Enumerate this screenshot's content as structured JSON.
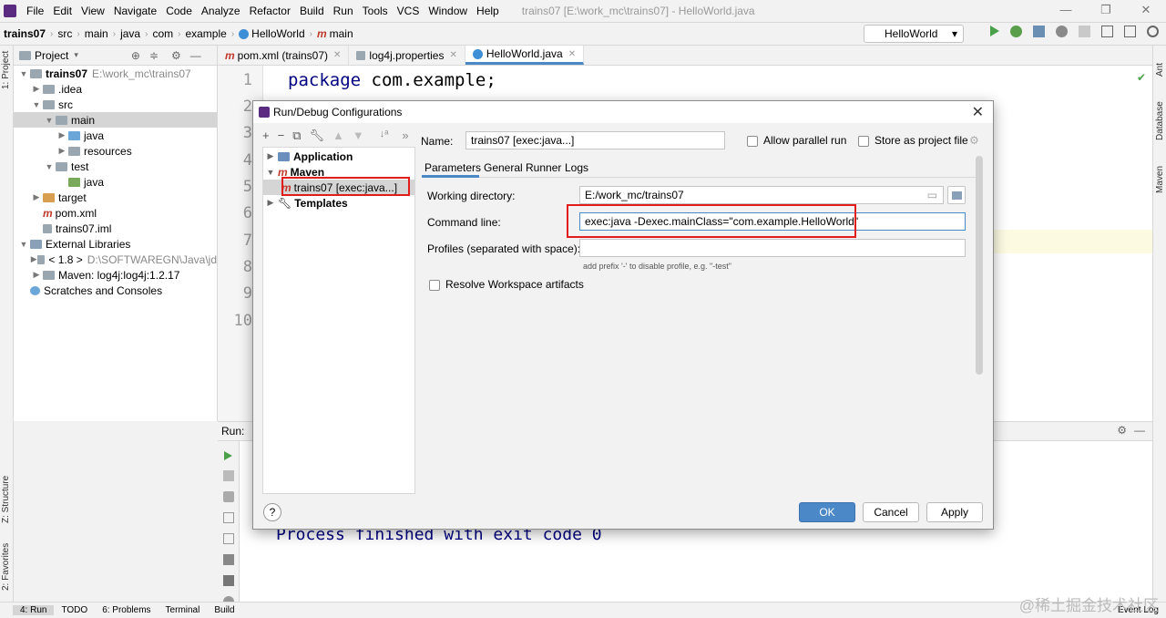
{
  "menubar": {
    "items": [
      "File",
      "Edit",
      "View",
      "Navigate",
      "Code",
      "Analyze",
      "Refactor",
      "Build",
      "Run",
      "Tools",
      "VCS",
      "Window",
      "Help"
    ],
    "title": "trains07 [E:\\work_mc\\trains07] - HelloWorld.java"
  },
  "navbar": {
    "crumbs": [
      "trains07",
      "src",
      "main",
      "java",
      "com",
      "example",
      "HelloWorld",
      "main"
    ]
  },
  "run_config_select": "HelloWorld",
  "left_strip": {
    "project": "1: Project",
    "structure": "Z: Structure",
    "favorites": "2: Favorites"
  },
  "right_strip": {
    "ant": "Ant",
    "database": "Database",
    "maven": "Maven"
  },
  "project_panel": {
    "header": "Project",
    "tree": [
      {
        "label": "trains07",
        "extra": "E:\\work_mc\\trains07"
      },
      {
        "label": ".idea"
      },
      {
        "label": "src"
      },
      {
        "label": "main"
      },
      {
        "label": "java"
      },
      {
        "label": "resources"
      },
      {
        "label": "test"
      },
      {
        "label": "java"
      },
      {
        "label": "target"
      },
      {
        "label": "pom.xml"
      },
      {
        "label": "trains07.iml"
      },
      {
        "label": "External Libraries"
      },
      {
        "label": "< 1.8 >",
        "extra": "D:\\SOFTWAREGN\\Java\\jd"
      },
      {
        "label": "Maven: log4j:log4j:1.2.17"
      },
      {
        "label": "Scratches and Consoles"
      }
    ]
  },
  "editor": {
    "tabs": [
      "pom.xml (trains07)",
      "log4j.properties",
      "HelloWorld.java"
    ],
    "line_numbers": [
      "1",
      "2",
      "3",
      "4",
      "5",
      "6",
      "7",
      "8",
      "9",
      "10"
    ],
    "code_kw": "package",
    "code_rest": " com.example;"
  },
  "run_panel": {
    "label": "Run:",
    "output": "Process finished with exit code 0"
  },
  "statusbar": {
    "items": [
      "4: Run",
      "TODO",
      "6: Problems",
      "Terminal",
      "Build"
    ],
    "event_log": "Event Log"
  },
  "watermark": "@稀土掘金技术社区",
  "dialog": {
    "title": "Run/Debug Configurations",
    "tree": {
      "application": "Application",
      "maven": "Maven",
      "config": "trains07 [exec:java...]",
      "templates": "Templates"
    },
    "name_label": "Name:",
    "name_value": "trains07 [exec:java...]",
    "allow_parallel": "Allow parallel run",
    "store_project": "Store as project file",
    "tabs": [
      "Parameters",
      "General",
      "Runner",
      "Logs"
    ],
    "working_dir_label": "Working directory:",
    "working_dir_value": "E:/work_mc/trains07",
    "command_line_label": "Command line:",
    "command_line_value": "exec:java -Dexec.mainClass=\"com.example.HelloWorld\"",
    "profiles_label": "Profiles (separated with space):",
    "profiles_hint": "add prefix '-' to disable profile, e.g. \"-test\"",
    "resolve_workspace": "Resolve Workspace artifacts",
    "buttons": {
      "ok": "OK",
      "cancel": "Cancel",
      "apply": "Apply",
      "help": "?"
    }
  },
  "colors": {
    "accent": "#4a88c7",
    "highlight_box": "#e21b1b",
    "keyword": "#000080"
  }
}
